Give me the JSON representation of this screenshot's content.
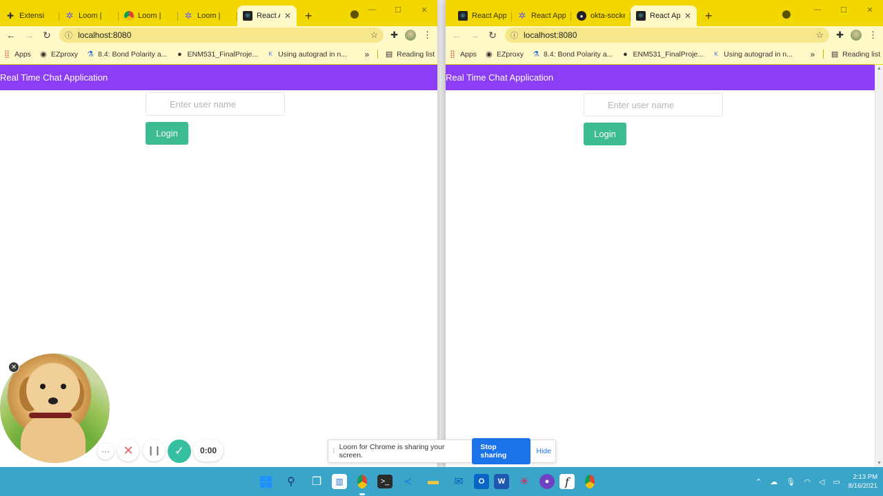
{
  "left_browser": {
    "tabs": [
      {
        "icon": "puzzle-icon",
        "title": "Extensi",
        "active": false
      },
      {
        "icon": "gear-icon",
        "title": "Loom |",
        "active": false
      },
      {
        "icon": "chrome-icon",
        "title": "Loom |",
        "active": false
      },
      {
        "icon": "gear-icon",
        "title": "Loom |",
        "active": false
      },
      {
        "icon": "react-icon",
        "title": "React A",
        "active": true
      }
    ],
    "url": "localhost:8080",
    "bookmarks": [
      "Apps",
      "EZproxy",
      "8.4: Bond Polarity a...",
      "ENM531_FinalProje...",
      "Using autograd in n..."
    ],
    "reading_list": "Reading list",
    "app_title": "Real Time Chat Application",
    "username_placeholder": "Enter user name",
    "login_label": "Login"
  },
  "right_browser": {
    "tabs": [
      {
        "icon": "react-icon",
        "title": "React App",
        "active": false
      },
      {
        "icon": "gear-icon",
        "title": "React App",
        "active": false
      },
      {
        "icon": "github-icon",
        "title": "okta-socke",
        "active": false
      },
      {
        "icon": "react-icon",
        "title": "React App",
        "active": true
      }
    ],
    "url": "localhost:8080",
    "bookmarks": [
      "Apps",
      "EZproxy",
      "8.4: Bond Polarity a...",
      "ENM531_FinalProje...",
      "Using autograd in n..."
    ],
    "reading_list": "Reading list",
    "app_title": "Real Time Chat Application",
    "username_placeholder": "Enter user name",
    "login_label": "Login"
  },
  "loom": {
    "timer": "0:00",
    "share_message": "Loom for Chrome is sharing your screen.",
    "stop_label": "Stop sharing",
    "hide_label": "Hide"
  },
  "taskbar": {
    "time": "2:13 PM",
    "date": "8/16/2021"
  },
  "colors": {
    "chrome_frame": "#f3d700",
    "app_header": "#8c3ef4",
    "login_button": "#3dbd8f",
    "taskbar": "#3aa4c9",
    "stop_button": "#1a73e8"
  }
}
